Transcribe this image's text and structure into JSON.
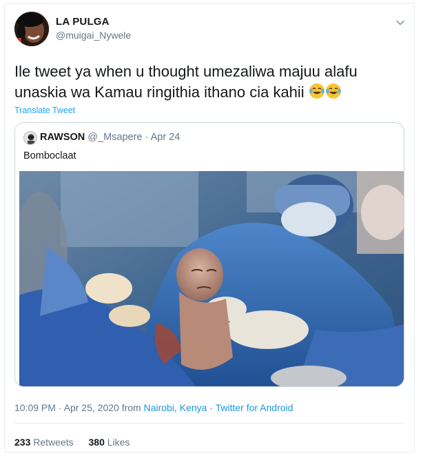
{
  "author": {
    "name": "LA PULGA",
    "handle": "@muigai_Nywele"
  },
  "tweet": {
    "text": "Ile tweet ya when u thought umezaliwa  majuu alafu unaskia wa Kamau ringithia ithano cia kahii",
    "translate_label": "Translate Tweet"
  },
  "quoted_tweet": {
    "name": "RAWSON",
    "handle": "@_Msapere",
    "separator": "·",
    "date": "Apr 24",
    "text": "Bomboclaat",
    "media_icon": "photo-newborn-surgery"
  },
  "footer": {
    "time": "10:09 PM",
    "date": "Apr 25, 2020",
    "from_label": "from",
    "location": "Nairobi, Kenya",
    "separator": "·",
    "client": "Twitter for Android"
  },
  "stats": {
    "retweets_count": "233",
    "retweets_label": "Retweets",
    "likes_count": "380",
    "likes_label": "Likes"
  },
  "colors": {
    "link": "#1b95e0",
    "muted": "#657786",
    "border": "#e6ecf0",
    "text": "#14171a"
  }
}
